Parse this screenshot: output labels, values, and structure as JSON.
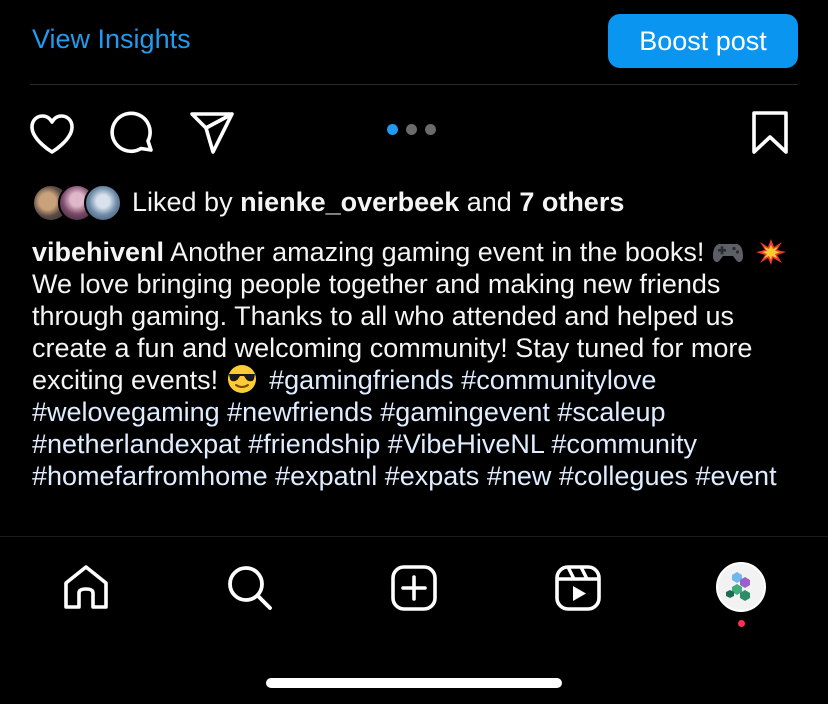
{
  "header": {
    "view_insights_label": "View Insights",
    "boost_label": "Boost post"
  },
  "actions": {
    "icons": [
      "heart-icon",
      "comment-icon",
      "share-icon",
      "bookmark-icon"
    ],
    "carousel": {
      "count": 3,
      "active_index": 0
    }
  },
  "likes": {
    "prefix": "Liked by",
    "user": "nienke_overbeek",
    "middle": "and",
    "others": "7 others"
  },
  "caption": {
    "username": "vibehivenl",
    "text_1": "Another amazing gaming event in the books!",
    "emoji_1": "🎮",
    "emoji_2": "💥",
    "text_2": "We love bringing people together and making new friends through gaming. Thanks to all who attended and helped us create a fun and welcoming community! Stay tuned for more exciting events!",
    "emoji_3": "😎",
    "hashtags": [
      "#gamingfriends",
      "#communitylove",
      "#welovegaming",
      "#newfriends",
      "#gamingevent",
      "#scaleup",
      "#netherlandexpat",
      "#friendship",
      "#VibeHiveNL",
      "#community",
      "#homefarfromhome",
      "#expatnl",
      "#expats",
      "#new",
      "#collegues",
      "#event"
    ]
  },
  "tabbar": {
    "items": [
      "home-icon",
      "search-icon",
      "create-icon",
      "reels-icon",
      "profile-avatar"
    ]
  },
  "colors": {
    "accent": "#1f9bf0",
    "boost_bg": "#0a95f0",
    "background": "#000000",
    "text": "#f5f5f5",
    "notification": "#ff2f55"
  }
}
